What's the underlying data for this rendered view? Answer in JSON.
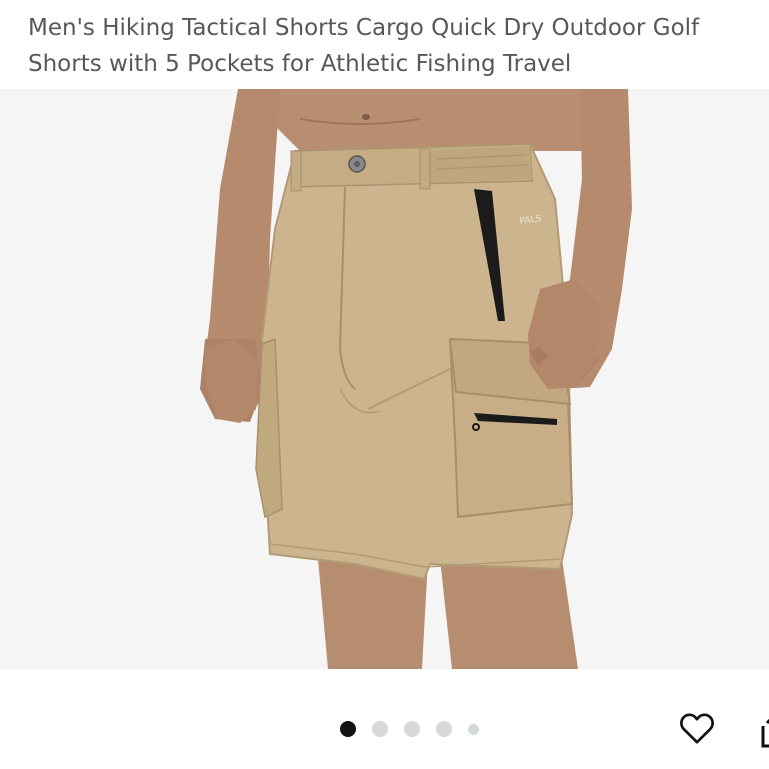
{
  "product": {
    "title": "Men's Hiking Tactical Shorts Cargo Quick Dry Outdoor Golf Shorts with 5 Pockets for Athletic Fishing Travel"
  },
  "gallery": {
    "image_count": 5,
    "active_index": 1
  },
  "actions": {
    "wishlist_icon": "heart-outline-icon",
    "share_icon": "share-icon"
  },
  "colors": {
    "title_text": "#565959",
    "image_background": "#f5f5f5",
    "shorts_khaki": "#cbb48e",
    "active_dot": "#111111",
    "inactive_dot": "#d5d9d9"
  }
}
